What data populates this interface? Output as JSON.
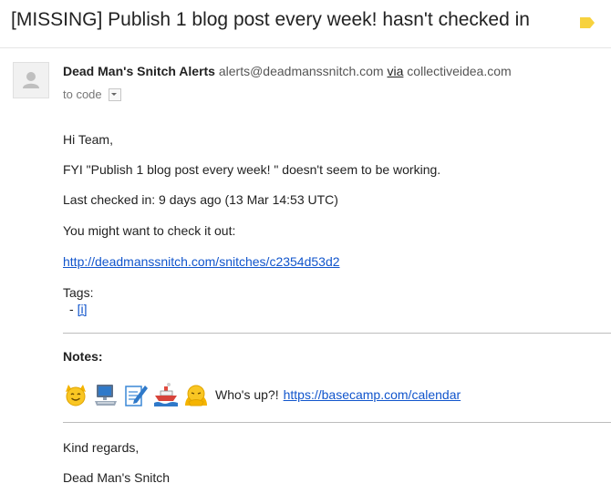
{
  "email": {
    "subject": "[MISSING] Publish 1 blog post every week! hasn't checked in",
    "sender": {
      "name": "Dead Man's Snitch Alerts",
      "address": "alerts@deadmanssnitch.com",
      "via_label": "via",
      "via_domain": "collectiveidea.com"
    },
    "recipient": "to code",
    "colors": {
      "link": "#1155cc",
      "label_tag": "#f7d23e",
      "text": "#222222",
      "muted": "#777777"
    }
  },
  "body": {
    "greeting": "Hi Team,",
    "line_fyi": "FYI \"Publish 1 blog post every week! \" doesn't seem to be working.",
    "line_last_checked": "Last checked in: 9 days ago (13 Mar 14:53 UTC)",
    "line_check_out": "You might want to check it out:",
    "snitch_url": "http://deadmanssnitch.com/snitches/c2354d53d2",
    "tags_label": "Tags:",
    "tag_prefix": "- ",
    "tag_item": "[i]",
    "notes_label": "Notes:",
    "notes_emojis": [
      "smiling-face-icon",
      "computer-icon",
      "memo-icon",
      "ship-icon",
      "praying-person-icon"
    ],
    "notes_text": "Who's up?!",
    "notes_url": "https://basecamp.com/calendar",
    "closing": "Kind regards,",
    "signature": "Dead Man's Snitch"
  }
}
